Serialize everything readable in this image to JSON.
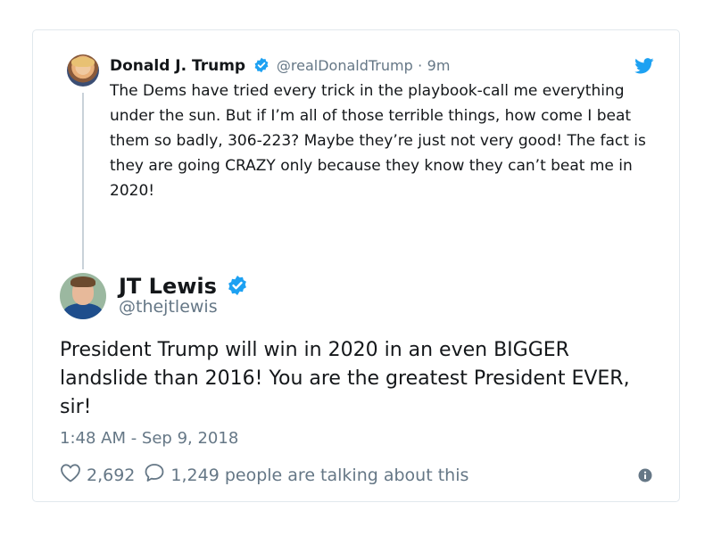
{
  "quoted_tweet": {
    "name": "Donald J. Trump",
    "handle": "@realDonaldTrump",
    "separator": "·",
    "age": "9m",
    "text": "The Dems have tried every trick in the playbook-call me everything under the sun. But if I’m all of those terrible things, how come I beat them so badly, 306-223? Maybe they’re just not very good! The fact is they are going CRAZY only because they know they can’t beat me in 2020!"
  },
  "tweet": {
    "name": "JT Lewis",
    "handle": "@thejtlewis",
    "text": "President Trump will win in 2020 in an even BIGGER landslide than 2016! You are the greatest President EVER, sir!",
    "timestamp": "1:48 AM - Sep 9, 2018",
    "likes": "2,692",
    "talking": "1,249 people are talking about this"
  },
  "colors": {
    "verified": "#1da1f2",
    "bird": "#1da1f2",
    "muted": "#657786",
    "thread_line": "#c9d2d9"
  },
  "icons": [
    "verified-badge-icon",
    "twitter-bird-icon",
    "heart-icon",
    "comment-bubble-icon",
    "info-icon"
  ]
}
